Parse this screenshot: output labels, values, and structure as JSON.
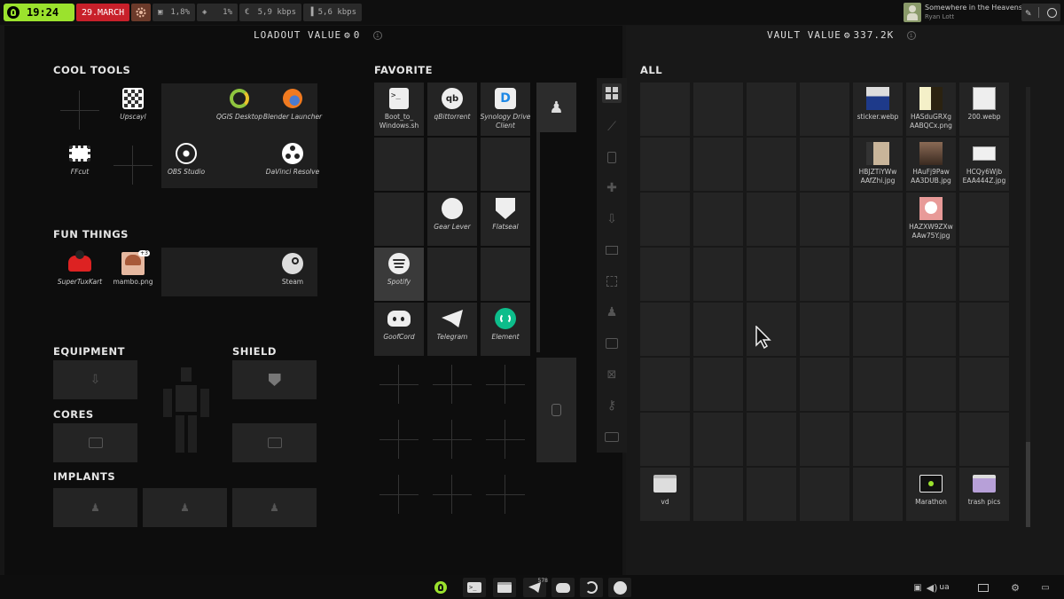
{
  "topbar": {
    "time": "19:24",
    "date": "29.MARCH",
    "cpu": "1,8%",
    "ram": "1%",
    "net_down": "5,9 kbps",
    "net_up": "5,6 kbps",
    "media_title": "Somewhere in the Heavens",
    "media_artist": "Ryan Lott"
  },
  "loadout": {
    "label": "LOADOUT VALUE",
    "value": "0"
  },
  "vault": {
    "label": "VAULT VALUE",
    "value": "337.2K"
  },
  "sections": {
    "cool_tools": "COOL TOOLS",
    "fun_things": "FUN THINGS",
    "equipment": "EQUIPMENT",
    "shield": "SHIELD",
    "cores": "CORES",
    "implants": "IMPLANTS",
    "favorite": "FAVORITE",
    "all": "ALL"
  },
  "cool_tools": [
    "Upscayl",
    "QGIS Desktop",
    "Blender Launcher",
    "FFcut",
    "OBS Studio",
    "DaVinci Resolve"
  ],
  "fun_things": [
    "SuperTuxKart",
    "mambo.png",
    "Steam"
  ],
  "fun_badge": "+3",
  "favorites": [
    "Boot_to_ Windows.sh",
    "qBittorrent",
    "Synology Drive Client",
    "Gear Lever",
    "Flatseal",
    "Spotify",
    "GoofCord",
    "Telegram",
    "Element"
  ],
  "all_items": [
    "sticker.webp",
    "HASduGRXg AABQCx.png",
    "200.webp",
    "HBJZTiYWw AAfZhi.jpg",
    "HAuFj9Paw AA3DUB.jpg",
    "HCQy6Wjb EAA444Z.jpg",
    "HAZXW9ZXw AAw75Y.jpg",
    "vd",
    "Marathon",
    "trash pics"
  ],
  "taskbar": {
    "telegram_badge": "578",
    "lang": "ua"
  },
  "colors": {
    "accent_green": "#9be22d",
    "date_red": "#c8202a",
    "bg": "#0d0d0d"
  }
}
